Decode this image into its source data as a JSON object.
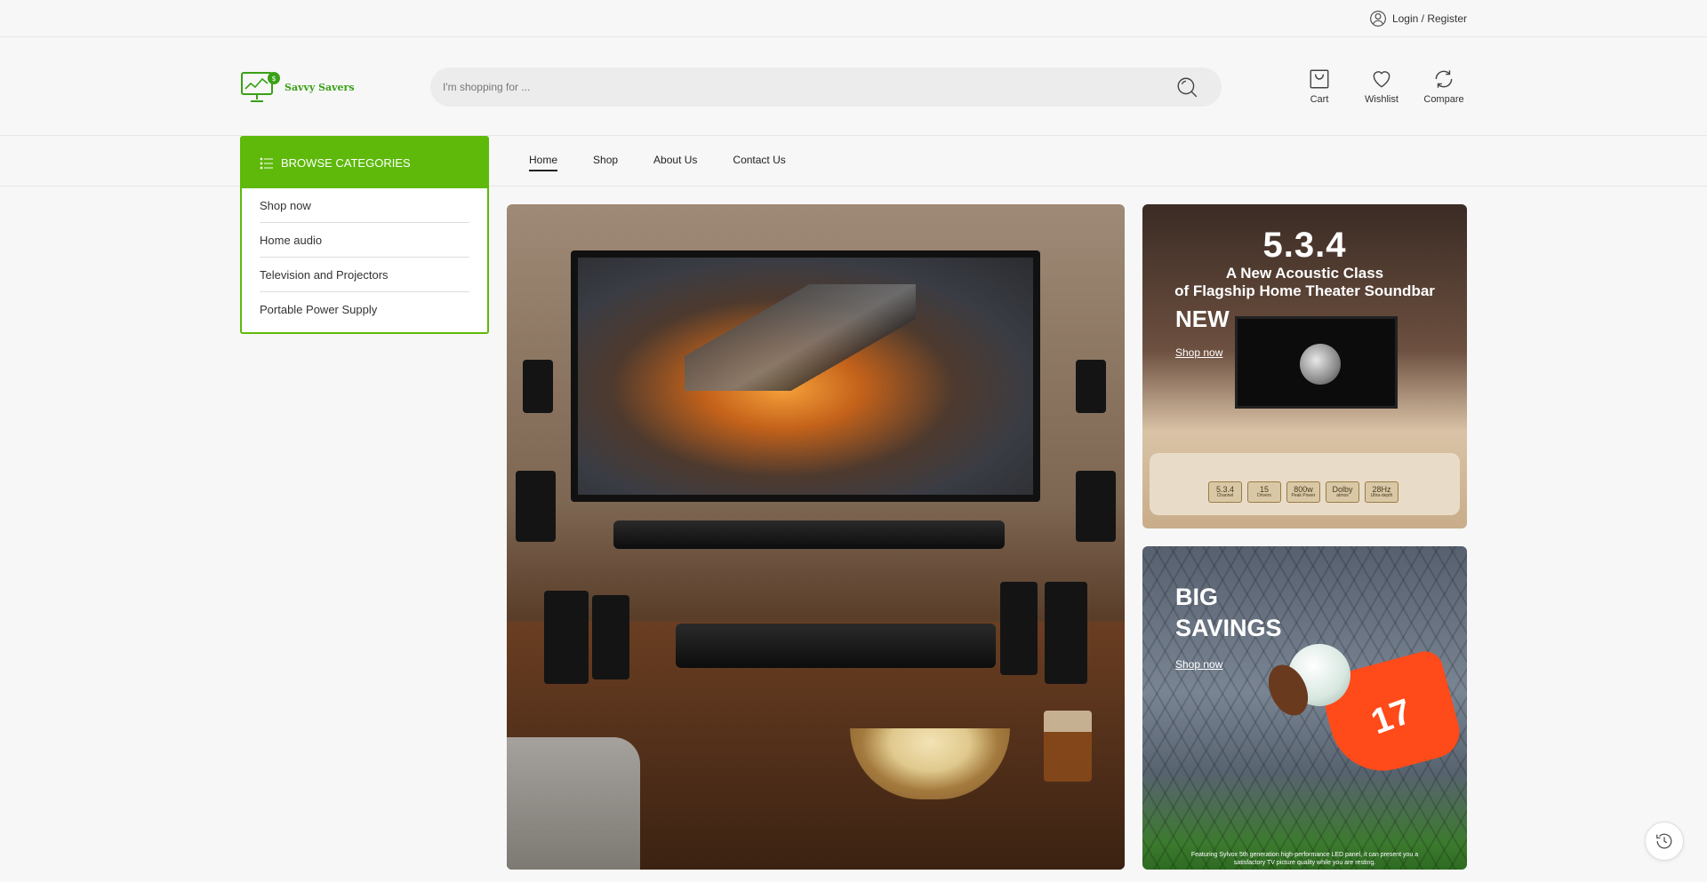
{
  "topbar": {
    "login_label": "Login / Register"
  },
  "header": {
    "logo_text": "Savvy Savers",
    "search": {
      "placeholder": "I'm shopping for ..."
    },
    "actions": {
      "cart": "Cart",
      "wishlist": "Wishlist",
      "compare": "Compare"
    }
  },
  "browse": {
    "title": "BROWSE CATEGORIES",
    "items": [
      "Shop now",
      "Home audio",
      "Television and Projectors",
      "Portable Power Supply"
    ]
  },
  "nav": {
    "items": [
      "Home",
      "Shop",
      "About Us",
      "Contact Us"
    ],
    "active": "Home"
  },
  "banners": {
    "top": {
      "number": "5.3.4",
      "line1": "A New Acoustic Class",
      "line2": "of Flagship Home Theater Soundbar",
      "label": "NEW",
      "shop": "Shop now",
      "badges": [
        {
          "value": "5.3.4",
          "sub": "Channel"
        },
        {
          "value": "15",
          "sub": "Drivers"
        },
        {
          "value": "800w",
          "sub": "Peak Power"
        },
        {
          "value": "Dolby",
          "sub": "atmos"
        },
        {
          "value": "28Hz",
          "sub": "Ultra-depth"
        }
      ]
    },
    "bottom": {
      "line1": "BIG",
      "line2": "SAVINGS",
      "shop": "Shop now",
      "jersey_number": "17",
      "footnote_1": "Featuring Sylvox 5th generation high-performance LED panel, it can present you a",
      "footnote_2": "satisfactory TV picture quality while you are resting."
    }
  },
  "colors": {
    "accent": "#5eb90a",
    "background": "#f7f7f7",
    "logo_green": "#3aa017"
  }
}
